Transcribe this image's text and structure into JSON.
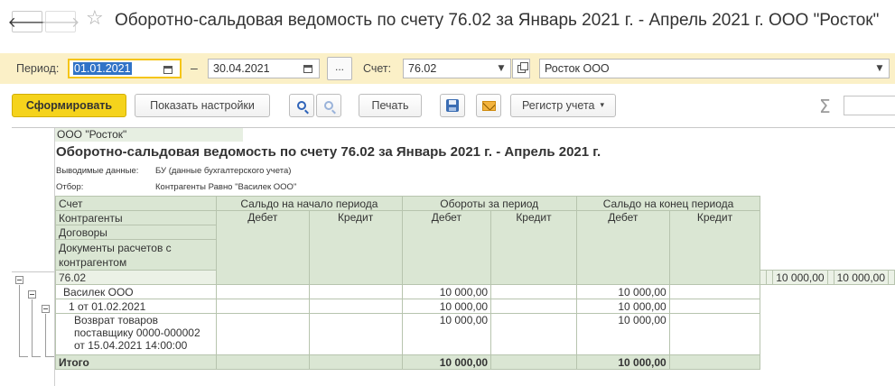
{
  "window": {
    "title": "Оборотно-сальдовая ведомость по счету 76.02 за Январь 2021 г. - Апрель 2021 г. ООО \"Росток\""
  },
  "filters": {
    "period_label": "Период:",
    "date_from": "01.01.2021",
    "dash": "–",
    "date_to": "30.04.2021",
    "more_label": "...",
    "account_label": "Счет:",
    "account_value": "76.02",
    "org_value": "Росток ООО"
  },
  "actions": {
    "generate": "Сформировать",
    "show_settings": "Показать настройки",
    "print": "Печать",
    "register": "Регистр учета",
    "sum_symbol": "Σ"
  },
  "report": {
    "org": "ООО \"Росток\"",
    "title": "Оборотно-сальдовая ведомость по счету 76.02 за Январь 2021 г. - Апрель 2021 г.",
    "data_label": "Выводимые данные:",
    "data_value": "БУ (данные бухгалтерского учета)",
    "filter_label": "Отбор:",
    "filter_value": "Контрагенты Равно \"Василек ООО\"",
    "headers": {
      "account": "Счет",
      "counterparties": "Контрагенты",
      "contracts": "Договоры",
      "documents": "Документы расчетов с контрагентом",
      "opening": "Сальдо на начало периода",
      "turnover": "Обороты за период",
      "closing": "Сальдо на конец периода",
      "debit": "Дебет",
      "credit": "Кредит"
    },
    "rows": [
      {
        "label": "76.02",
        "turn_debit": "10 000,00",
        "close_debit": "10 000,00"
      },
      {
        "label": "Василек ООО",
        "turn_debit": "10 000,00",
        "close_debit": "10 000,00"
      },
      {
        "label": "1 от 01.02.2021",
        "turn_debit": "10 000,00",
        "close_debit": "10 000,00"
      },
      {
        "label": "Возврат товаров поставщику 0000-000002 от 15.04.2021 14:00:00",
        "turn_debit": "10 000,00",
        "close_debit": "10 000,00"
      }
    ],
    "total": {
      "label": "Итого",
      "turn_debit": "10 000,00",
      "close_debit": "10 000,00"
    }
  }
}
